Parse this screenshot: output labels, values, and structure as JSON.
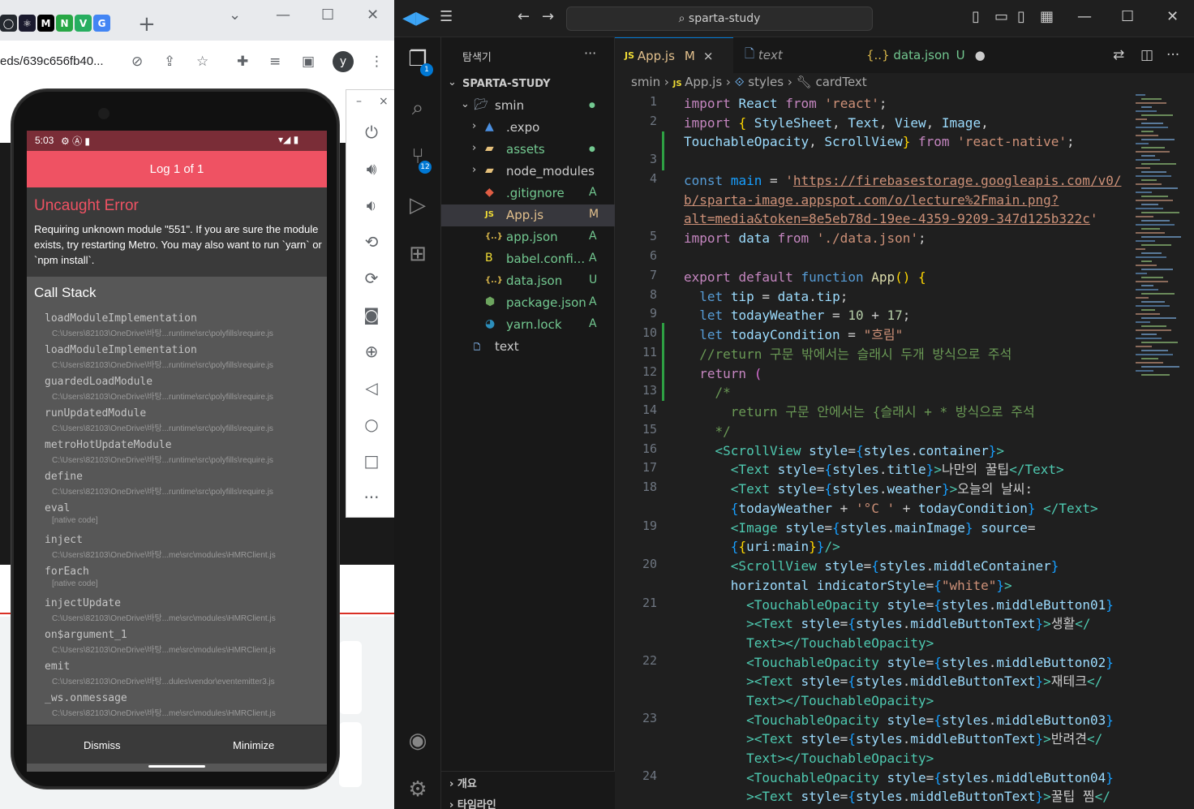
{
  "browser": {
    "favicons": [
      {
        "icon": "github-icon",
        "glyph": "◯",
        "color": "#24292f"
      },
      {
        "icon": "react-icon",
        "glyph": "⚛",
        "color": "#1a1a2e"
      },
      {
        "icon": "m-icon",
        "glyph": "M",
        "color": "#000000"
      },
      {
        "icon": "n-icon",
        "glyph": "N",
        "color": "#28a745"
      },
      {
        "icon": "v-icon",
        "glyph": "V",
        "color": "#27ae60"
      },
      {
        "icon": "google-icon",
        "glyph": "G",
        "color": "#4285f4"
      }
    ],
    "new_tab": "+",
    "url": "eds/639c656fb40...",
    "avatar": "y"
  },
  "phone": {
    "time": "5:03",
    "log_title": "Log 1 of 1",
    "error_title": "Uncaught Error",
    "error_message": "Requiring unknown module \"551\". If you are sure the module exists, try restarting Metro. You may also want to run `yarn` or `npm install`.",
    "call_stack_title": "Call Stack",
    "frames": [
      {
        "fn": "loadModuleImplementation",
        "path": "C:\\Users\\82103\\OneDrive\\바탕...runtime\\src\\polyfills\\require.js"
      },
      {
        "fn": "loadModuleImplementation",
        "path": "C:\\Users\\82103\\OneDrive\\바탕...runtime\\src\\polyfills\\require.js"
      },
      {
        "fn": "guardedLoadModule",
        "path": "C:\\Users\\82103\\OneDrive\\바탕...runtime\\src\\polyfills\\require.js"
      },
      {
        "fn": "runUpdatedModule",
        "path": "C:\\Users\\82103\\OneDrive\\바탕...runtime\\src\\polyfills\\require.js"
      },
      {
        "fn": "metroHotUpdateModule",
        "path": "C:\\Users\\82103\\OneDrive\\바탕...runtime\\src\\polyfills\\require.js"
      },
      {
        "fn": "define",
        "path": "C:\\Users\\82103\\OneDrive\\바탕...runtime\\src\\polyfills\\require.js"
      },
      {
        "fn": "eval",
        "path": "[native code]"
      },
      {
        "fn": "inject",
        "path": "C:\\Users\\82103\\OneDrive\\바탕...me\\src\\modules\\HMRClient.js"
      },
      {
        "fn": "forEach",
        "path": "[native code]"
      },
      {
        "fn": "injectUpdate",
        "path": "C:\\Users\\82103\\OneDrive\\바탕...me\\src\\modules\\HMRClient.js"
      },
      {
        "fn": "on$argument_1",
        "path": "C:\\Users\\82103\\OneDrive\\바탕...me\\src\\modules\\HMRClient.js"
      },
      {
        "fn": "emit",
        "path": "C:\\Users\\82103\\OneDrive\\바탕...dules\\vendor\\eventemitter3.js"
      },
      {
        "fn": "_ws.onmessage",
        "path": "C:\\Users\\82103\\OneDrive\\바탕...me\\src\\modules\\HMRClient.js"
      }
    ],
    "dismiss": "Dismiss",
    "minimize": "Minimize"
  },
  "emulator_panel": {
    "minimize": "–",
    "close": "×",
    "tools": [
      "power-icon",
      "volume-up-icon",
      "volume-down-icon",
      "rotate-left-icon",
      "rotate-right-icon",
      "camera-icon",
      "zoom-icon",
      "back-icon",
      "home-icon",
      "overview-icon",
      "more-icon"
    ]
  },
  "vscode": {
    "search": "sparta-study",
    "explorer_title": "탐색기",
    "explorer_more": "···",
    "root": "SPARTA-STUDY",
    "tree": [
      {
        "label": "smin",
        "icon": "folder-open-icon",
        "status": "●",
        "status_color": "#73c991",
        "color": "#cccccc",
        "depth": 1,
        "chev": "⌄"
      },
      {
        "label": ".expo",
        "icon": "expo-folder-icon",
        "status": "",
        "status_color": "#cccccc",
        "color": "#cccccc",
        "depth": 2,
        "chev": "›"
      },
      {
        "label": "assets",
        "icon": "folder-icon",
        "status": "●",
        "status_color": "#73c991",
        "color": "#73c991",
        "depth": 2,
        "chev": "›"
      },
      {
        "label": "node_modules",
        "icon": "folder-icon",
        "status": "",
        "status_color": "#cccccc",
        "color": "#cccccc",
        "depth": 2,
        "chev": "›"
      },
      {
        "label": ".gitignore",
        "icon": "git-icon",
        "status": "A",
        "status_color": "#73c991",
        "color": "#73c991",
        "depth": 2,
        "chev": ""
      },
      {
        "label": "App.js",
        "icon": "js-icon",
        "status": "M",
        "status_color": "#e2c08d",
        "color": "#e2c08d",
        "depth": 2,
        "chev": ""
      },
      {
        "label": "app.json",
        "icon": "json-icon",
        "status": "A",
        "status_color": "#73c991",
        "color": "#73c991",
        "depth": 2,
        "chev": ""
      },
      {
        "label": "babel.confi...",
        "icon": "babel-icon",
        "status": "A",
        "status_color": "#73c991",
        "color": "#73c991",
        "depth": 2,
        "chev": ""
      },
      {
        "label": "data.json",
        "icon": "json-icon",
        "status": "U",
        "status_color": "#73c991",
        "color": "#73c991",
        "depth": 2,
        "chev": ""
      },
      {
        "label": "package.json",
        "icon": "node-icon",
        "status": "A",
        "status_color": "#73c991",
        "color": "#73c991",
        "depth": 2,
        "chev": ""
      },
      {
        "label": "yarn.lock",
        "icon": "yarn-icon",
        "status": "A",
        "status_color": "#73c991",
        "color": "#73c991",
        "depth": 2,
        "chev": ""
      },
      {
        "label": "text",
        "icon": "file-icon",
        "status": "",
        "status_color": "#cccccc",
        "color": "#cccccc",
        "depth": 1,
        "chev": ""
      }
    ],
    "outline": "개요",
    "timeline": "타임라인",
    "tabs": [
      {
        "label": "App.js",
        "status": "M",
        "close": "×"
      },
      {
        "label": "text",
        "status": "",
        "close": ""
      },
      {
        "label": "data.json",
        "status": "U",
        "close": "●"
      }
    ],
    "breadcrumb": [
      "smin",
      "App.js",
      "styles",
      "cardText"
    ],
    "badges": {
      "explorer": "1",
      "scm": "12"
    }
  }
}
